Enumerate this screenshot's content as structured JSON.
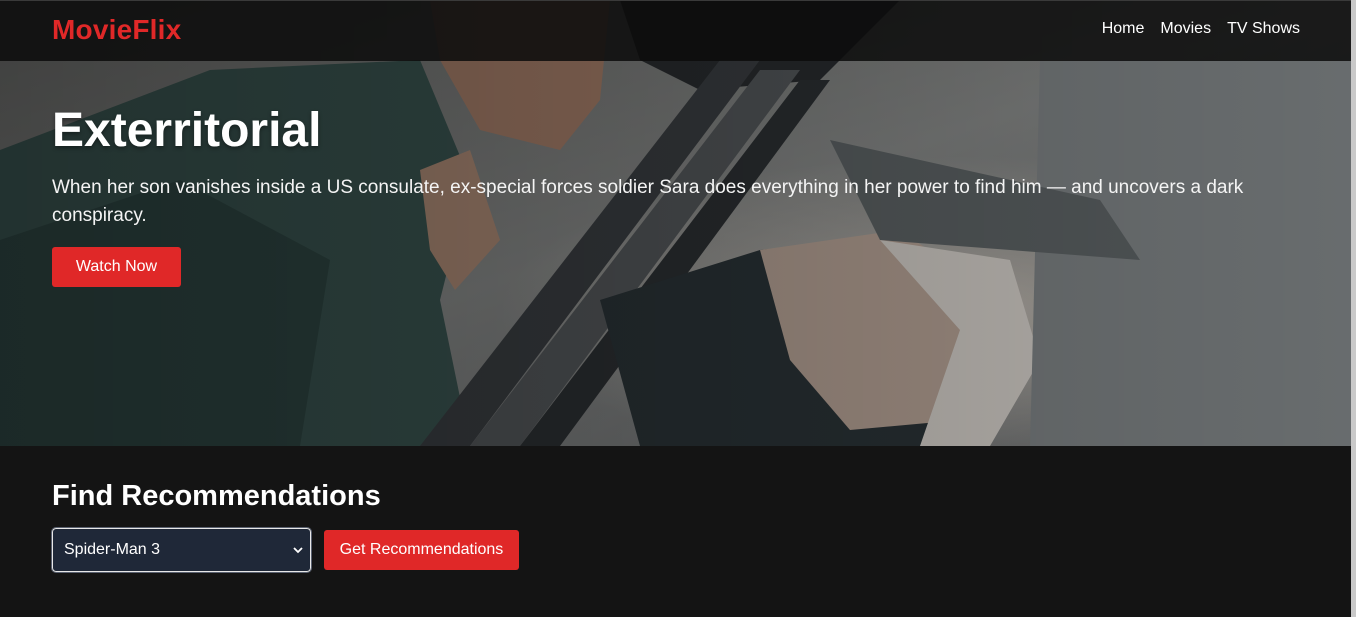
{
  "app": {
    "brand": "MovieFlix"
  },
  "nav": {
    "links": [
      "Home",
      "Movies",
      "TV Shows"
    ]
  },
  "hero": {
    "title": "Exterritorial",
    "description": "When her son vanishes inside a US consulate, ex-special forces soldier Sara does everything in her power to find him — and uncovers a dark conspiracy.",
    "cta_label": "Watch Now"
  },
  "recommendations": {
    "heading": "Find Recommendations",
    "selected_movie": "Spider-Man 3",
    "button_label": "Get Recommendations"
  },
  "colors": {
    "accent": "#e02828",
    "background": "#141414",
    "navbar": "#0c0c0c",
    "select_bg": "#1f2838"
  },
  "icons": {
    "select_chevron": "chevron-down-icon"
  }
}
